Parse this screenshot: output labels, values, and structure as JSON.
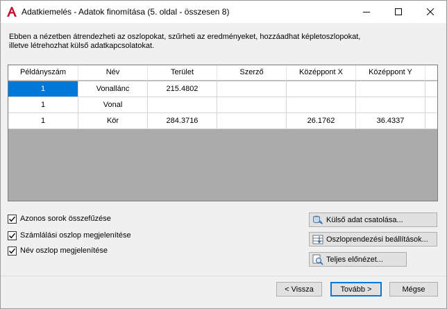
{
  "window": {
    "title": "Adatkiemelés - Adatok finomítása (5. oldal - összesen 8)"
  },
  "description": {
    "line1": "Ebben a nézetben átrendezheti az oszlopokat, szűrheti az eredményeket, hozzáadhat képletoszlopokat,",
    "line2": "illetve létrehozhat külső adatkapcsolatokat."
  },
  "table": {
    "headers": [
      "Példányszám",
      "Név",
      "Terület",
      "Szerző",
      "Középpont X",
      "Középpont Y"
    ],
    "rows": [
      [
        "1",
        "Vonallánc",
        "215.4802",
        "",
        "",
        ""
      ],
      [
        "1",
        "Vonal",
        "",
        "",
        "",
        ""
      ],
      [
        "1",
        "Kör",
        "284.3716",
        "",
        "26.1762",
        "36.4337"
      ]
    ],
    "selected_cell": "row 1, Példányszám"
  },
  "options": {
    "merge_rows": {
      "label": "Azonos sorok összefűzése",
      "checked": true
    },
    "show_count": {
      "label": "Számlálási oszlop megjelenítése",
      "checked": true
    },
    "show_name": {
      "label": "Név oszlop megjelenítése",
      "checked": true
    }
  },
  "actions": {
    "link_external": "Külső adat csatolása...",
    "column_sort": "Oszloprendezési beállítások...",
    "full_preview": "Teljes előnézet..."
  },
  "nav": {
    "back": "< Vissza",
    "next": "Tovább >",
    "cancel": "Mégse"
  },
  "colors": {
    "accent": "#0078d7",
    "app_icon": "#c8102e"
  }
}
